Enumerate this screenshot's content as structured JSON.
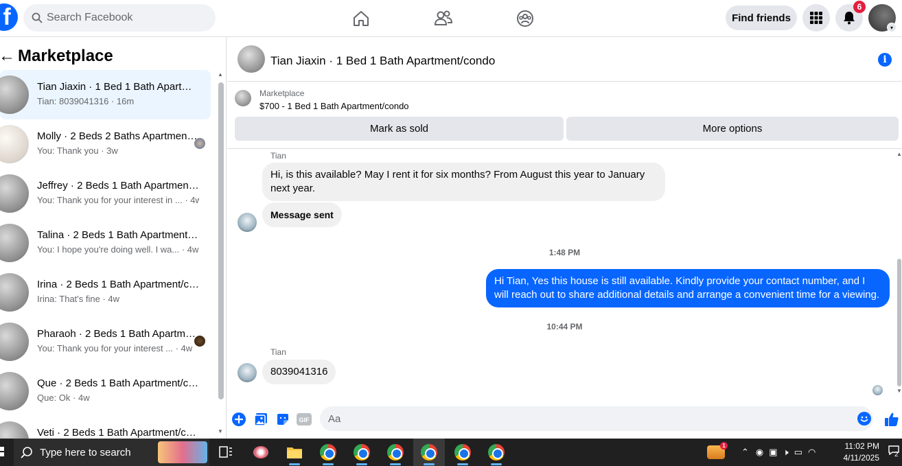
{
  "topbar": {
    "logo": "f",
    "search_placeholder": "Search Facebook",
    "find_friends": "Find friends",
    "notification_count": "6"
  },
  "sidebar": {
    "title": "Marketplace",
    "conversations": [
      {
        "name": "Tian Jiaxin · 1 Bed 1 Bath Apartment/condo",
        "snippet": "Tian: 8039041316 · 16m",
        "active": true
      },
      {
        "name": "Molly · 2 Beds 2 Baths Apartment/condo",
        "snippet": "You: Thank you · 3w"
      },
      {
        "name": "Jeffrey · 2 Beds 1 Bath Apartment/condo",
        "snippet": "You: Thank you for your interest in ... · 4w"
      },
      {
        "name": "Talina · 2 Beds 1 Bath Apartment/condo",
        "snippet": "You: I hope you're doing well. I wa... · 4w"
      },
      {
        "name": "Irina · 2 Beds 1 Bath Apartment/condo",
        "snippet": "Irina: That's fine · 4w"
      },
      {
        "name": "Pharaoh · 2 Beds 1 Bath Apartment/condo",
        "snippet": "You: Thank you for your interest ... · 4w"
      },
      {
        "name": "Que · 2 Beds 1 Bath Apartment/condo",
        "snippet": "Que: Ok · 4w"
      },
      {
        "name": "Veti · 2 Beds 1 Bath Apartment/condo",
        "snippet": ""
      }
    ]
  },
  "chat": {
    "title": "Tian Jiaxin · 1 Bed 1 Bath Apartment/condo",
    "marketplace_label": "Marketplace",
    "listing": "$700 - 1 Bed 1 Bath Apartment/condo",
    "mark_sold": "Mark as sold",
    "more_options": "More options",
    "messages": {
      "sender1": "Tian",
      "msg1": "Hi, is this available? May I rent it for six months? From August this year to January next year.",
      "msg2": "Message sent",
      "time1": "1:48 PM",
      "msg3": "Hi Tian, Yes this house is still available. Kindly provide your contact number, and I will reach out to share additional details and arrange a convenient time for a viewing.",
      "time2": "10:44 PM",
      "sender2": "Tian",
      "msg4": "8039041316"
    },
    "composer_placeholder": "Aa"
  },
  "taskbar": {
    "search_placeholder": "Type here to search",
    "time": "11:02 PM",
    "date": "4/11/2025",
    "notif": "2"
  }
}
